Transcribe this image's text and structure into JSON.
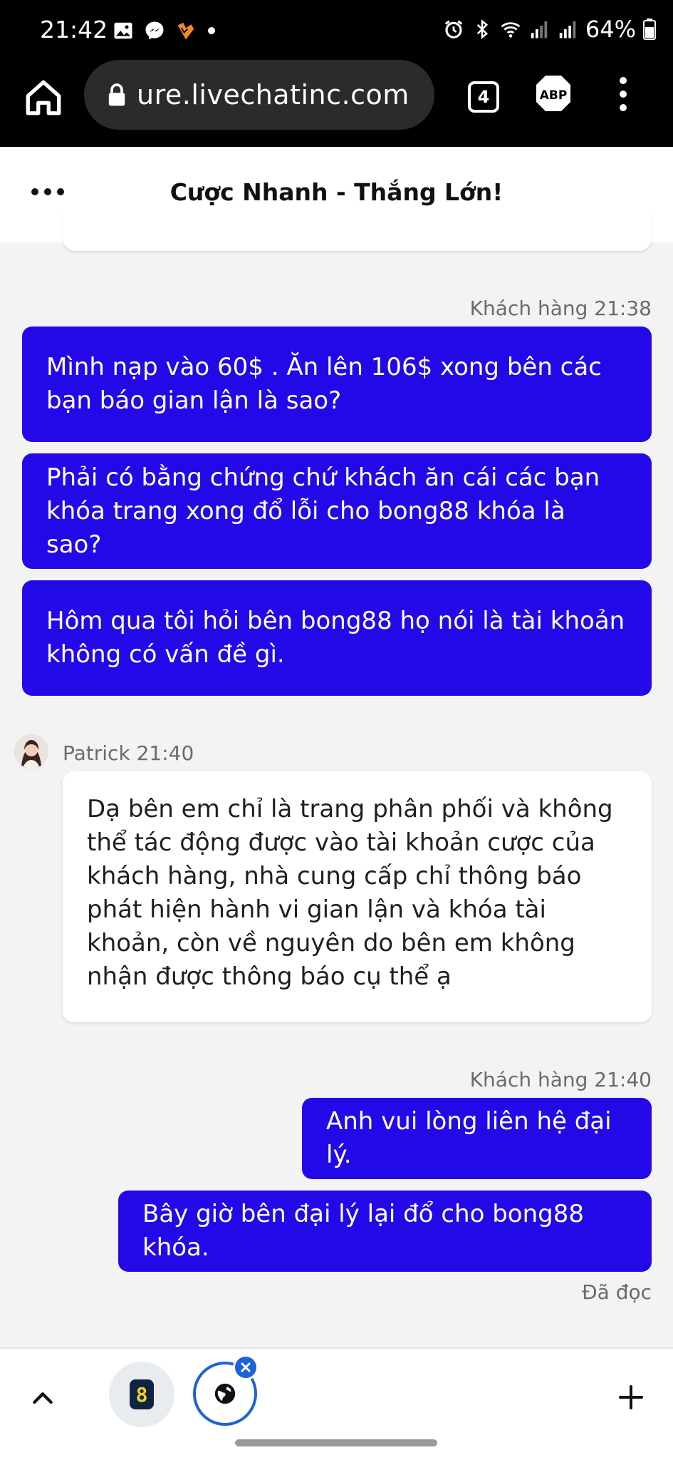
{
  "status_bar": {
    "time": "21:42",
    "battery": "64%",
    "icons": [
      "gallery-icon",
      "messenger-icon",
      "app-icon",
      "alarm-icon",
      "bluetooth-icon",
      "wifi-icon",
      "signal-icon",
      "battery-icon"
    ]
  },
  "browser": {
    "url": "ure.livechatinc.com",
    "tab_count": "4",
    "abp_label": "ABP"
  },
  "chat": {
    "title": "Cược Nhanh - Thắng Lớn!",
    "messages": [
      {
        "meta": "Khách hàng 21:38",
        "bubbles": [
          "Mình nạp vào 60$ . Ăn lên 106$ xong bên các bạn báo gian lận là sao?",
          "Phải có bằng chứng chứ khách ăn cái các bạn khóa trang xong đổ lỗi cho bong88 khóa là sao?",
          "Hôm qua tôi hỏi bên bong88 họ nói là tài khoản không có vấn đề gì."
        ]
      },
      {
        "meta": "Patrick 21:40",
        "text": "Dạ bên em chỉ là trang phân phối và không thể tác động được vào tài khoản cược của khách hàng, nhà cung cấp chỉ thông báo phát hiện hành vi gian lận và khóa tài khoản, còn về nguyên do bên em không nhận được thông báo cụ thể ạ"
      },
      {
        "meta": "Khách hàng 21:40",
        "bubbles": [
          "Anh vui lòng liên hệ đại lý.",
          "Bây giờ bên đại lý lại đổ cho bong88 khóa."
        ],
        "status": "Đã đọc"
      }
    ]
  },
  "bottom_nav": {
    "app_badge": "8"
  },
  "colors": {
    "outgoing_bubble": "#2309e8",
    "accent_blue": "#1d62d8"
  }
}
